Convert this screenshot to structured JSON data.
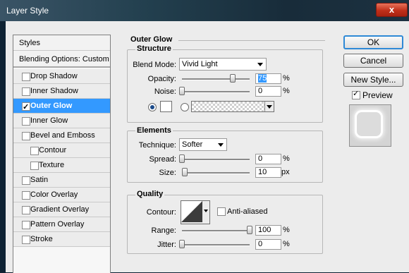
{
  "window": {
    "title": "Layer Style",
    "close_glyph": "x"
  },
  "sidebar": {
    "header": "Styles",
    "blending": "Blending Options: Custom",
    "items": [
      {
        "label": "Drop Shadow",
        "checked": false
      },
      {
        "label": "Inner Shadow",
        "checked": false
      },
      {
        "label": "Outer Glow",
        "checked": true,
        "selected": true
      },
      {
        "label": "Inner Glow",
        "checked": false
      },
      {
        "label": "Bevel and Emboss",
        "checked": false
      },
      {
        "label": "Contour",
        "checked": false
      },
      {
        "label": "Texture",
        "checked": false
      },
      {
        "label": "Satin",
        "checked": false
      },
      {
        "label": "Color Overlay",
        "checked": false
      },
      {
        "label": "Gradient Overlay",
        "checked": false
      },
      {
        "label": "Pattern Overlay",
        "checked": false
      },
      {
        "label": "Stroke",
        "checked": false
      }
    ]
  },
  "outer_glow": {
    "title": "Outer Glow",
    "structure": {
      "title": "Structure",
      "blend_mode_label": "Blend Mode:",
      "blend_mode": "Vivid Light",
      "opacity_label": "Opacity:",
      "opacity": "75",
      "opacity_level": 75,
      "noise_label": "Noise:",
      "noise": "0",
      "noise_level": 0,
      "color_radio_selected": true,
      "glow_color": "#ffffff"
    },
    "elements": {
      "title": "Elements",
      "technique_label": "Technique:",
      "technique": "Softer",
      "spread_label": "Spread:",
      "spread": "0",
      "spread_level": 0,
      "size_label": "Size:",
      "size": "10",
      "size_level": 4
    },
    "quality": {
      "title": "Quality",
      "contour_label": "Contour:",
      "anti_aliased_label": "Anti-aliased",
      "anti_aliased": false,
      "range_label": "Range:",
      "range": "100",
      "range_level": 100,
      "jitter_label": "Jitter:",
      "jitter": "0",
      "jitter_level": 0
    },
    "units": {
      "percent": "%",
      "px": "px"
    }
  },
  "buttons": {
    "ok": "OK",
    "cancel": "Cancel",
    "new_style": "New Style...",
    "preview_label": "Preview",
    "preview_checked": true
  },
  "colors": {
    "selection": "#3399ff",
    "accent_border": "#2e89d6"
  }
}
